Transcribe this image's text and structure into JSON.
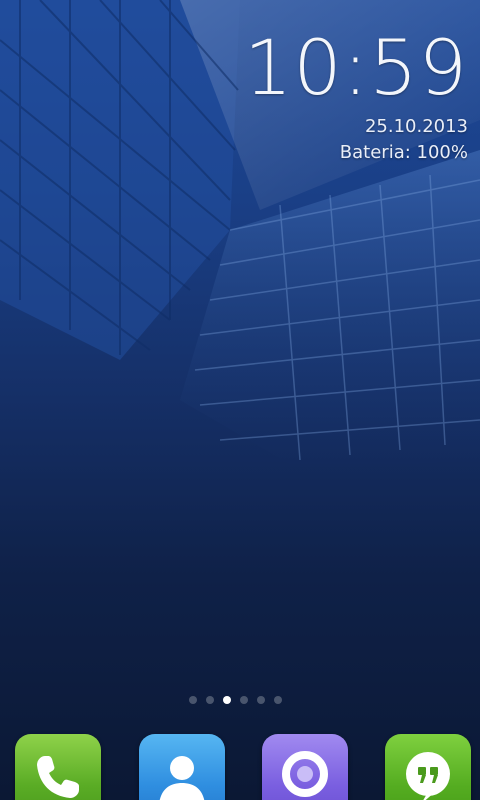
{
  "clock": {
    "time": "10:59",
    "date": "25.10.2013",
    "battery": "Bateria: 100%"
  },
  "home": {
    "page_count": 6,
    "active_page": 3
  },
  "dock": {
    "apps": [
      {
        "icon": "phone-icon",
        "color": "#5aac25"
      },
      {
        "icon": "contacts-icon",
        "color": "#2f8ee0"
      },
      {
        "icon": "browser-icon",
        "color": "#7a5fe0"
      },
      {
        "icon": "hangouts-icon",
        "color": "#55ad21"
      }
    ]
  },
  "colors": {
    "wallpaper_top": "#1e4a9a",
    "wallpaper_bottom": "#0b1834",
    "text": "#ffffff"
  }
}
